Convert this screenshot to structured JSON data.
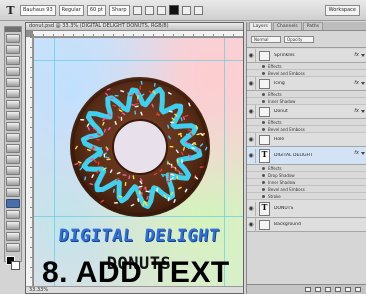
{
  "options_bar": {
    "tool_glyph": "T",
    "font_family": "Bauhaus 93",
    "font_style": "Regular",
    "font_size": "60 pt",
    "anti_alias": "Sharp",
    "workspace": "Workspace"
  },
  "document": {
    "title": "donut.psd @ 33.3% (DIGITAL DELIGHT DONUTS, RGB/8)",
    "headline_line1": "DIGITAL DELIGHT",
    "headline_line2": "DONUTS",
    "status_text": "33.33%"
  },
  "layers_panel": {
    "tabs": [
      "Layers",
      "Channels",
      "Paths"
    ],
    "blend_mode": "Normal",
    "opacity": "Opacity",
    "layers": [
      {
        "name": "Sprinkles",
        "type": "image",
        "fx": "fx",
        "effects": [
          "Effects",
          "Bevel and Emboss"
        ]
      },
      {
        "name": "Icing",
        "type": "image",
        "fx": "fx",
        "effects": [
          "Effects",
          "Inner Shadow"
        ]
      },
      {
        "name": "Donut",
        "type": "image",
        "fx": "fx",
        "effects": [
          "Effects",
          "Bevel and Emboss"
        ]
      },
      {
        "name": "Hole",
        "type": "image",
        "fx": "",
        "effects": []
      },
      {
        "name": "DIGITAL DELIGHT",
        "type": "text",
        "fx": "fx",
        "selected": true,
        "effects": [
          "Effects",
          "Drop Shadow",
          "Inner Shadow",
          "Bevel and Emboss",
          "Stroke"
        ]
      },
      {
        "name": "DONUTS",
        "type": "text",
        "fx": "",
        "effects": []
      },
      {
        "name": "Background",
        "type": "image",
        "fx": "",
        "effects": []
      }
    ]
  },
  "caption": {
    "text": "8. ADD TEXT"
  },
  "colors": {
    "headline_blue": "#2f6fd8",
    "headline_dark": "#151515",
    "chocolate": "#5a2d17",
    "icing_cyan": "#3fd0f0",
    "sprinkle_yellow": "#f4e23a",
    "sprinkle_pink": "#f05aa0",
    "sprinkle_red": "#e23b2a"
  }
}
